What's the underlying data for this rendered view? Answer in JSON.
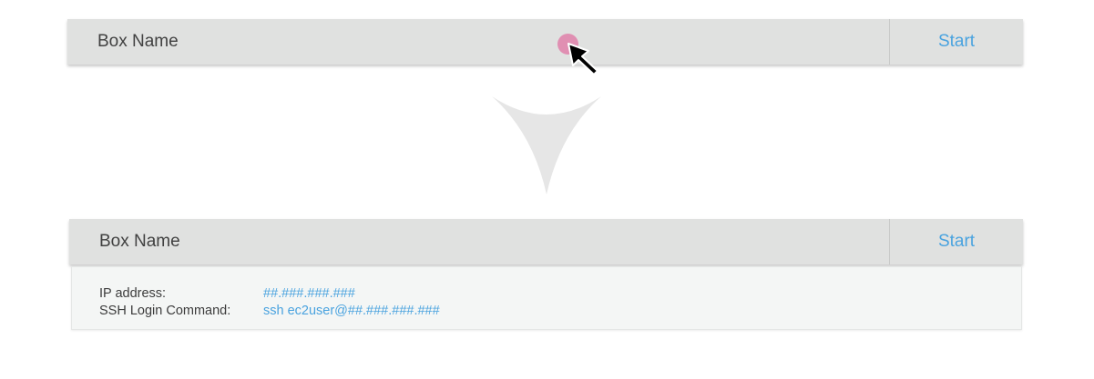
{
  "before": {
    "box_name": "Box Name",
    "start_label": "Start"
  },
  "after": {
    "box_name": "Box Name",
    "start_label": "Start",
    "details": {
      "ip_label": "IP address:",
      "ip_value": "##.###.###.###",
      "ssh_label": "SSH Login Command:",
      "ssh_value": "ssh ec2user@##.###.###.###"
    }
  },
  "colors": {
    "bar_background": "#e0e1e0",
    "accent_blue": "#4aa3df",
    "click_indicator": "#e08fb2",
    "transition_arrow": "#e6e6e6"
  },
  "icons": {
    "cursor": "mouse-pointer-icon",
    "click": "click-indicator-icon",
    "transition": "down-arrow-icon"
  }
}
